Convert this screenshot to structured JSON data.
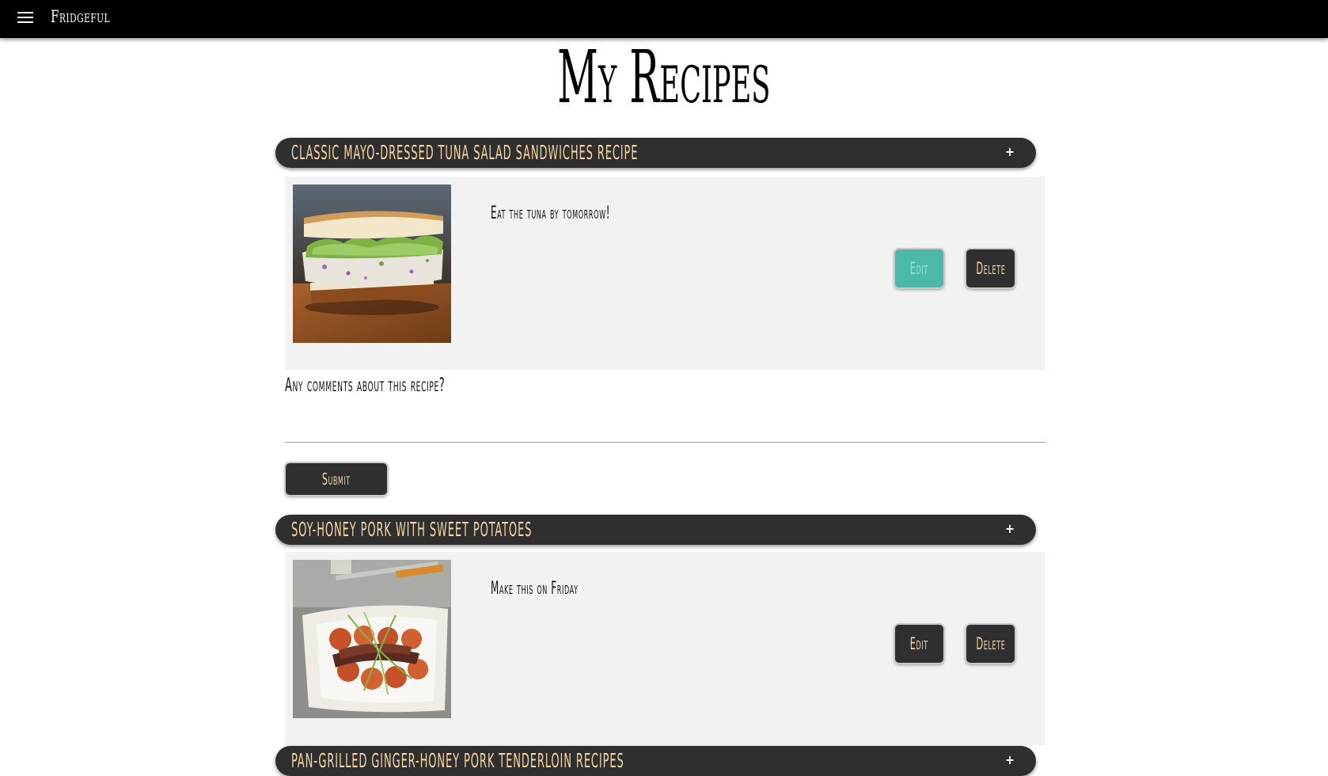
{
  "navbar": {
    "brand": "Fridgeful",
    "menu_icon": "hamburger-menu-icon"
  },
  "page": {
    "title": "My Recipes"
  },
  "colors": {
    "navbar_bg": "#000000",
    "header_bg": "#2f2f2f",
    "header_text": "#f5d5a4",
    "card_bg": "#f2f2f2",
    "edit_active": "#4bb8a9"
  },
  "recipes": [
    {
      "title": "Classic Mayo-Dressed Tuna Salad Sandwiches Recipe",
      "toggle": "+",
      "note": "Eat the tuna by tomorrow!",
      "image": "tuna-salad-sandwich-image",
      "edit_label": "Edit",
      "delete_label": "Delete"
    },
    {
      "title": "Soy-Honey Pork with Sweet Potatoes",
      "toggle": "+",
      "note": "Make this on Friday",
      "image": "soy-honey-pork-image",
      "edit_label": "Edit",
      "delete_label": "Delete"
    },
    {
      "title": "Pan-Grilled Ginger-Honey Pork Tenderloin Recipes",
      "toggle": "+"
    }
  ],
  "comments": {
    "label": "Any comments about this recipe?",
    "value": "",
    "placeholder": "",
    "submit_label": "Submit"
  }
}
